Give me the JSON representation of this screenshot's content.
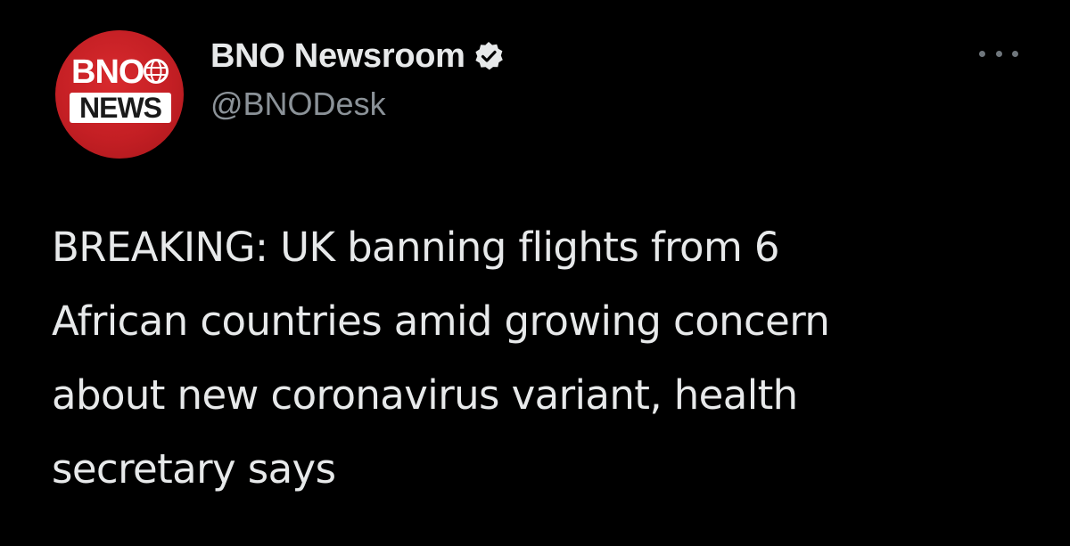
{
  "avatar": {
    "logo_top": "BNO",
    "logo_bottom": "NEWS",
    "logo_color": "#c41f24"
  },
  "author": {
    "display_name": "BNO Newsroom",
    "handle": "@BNODesk",
    "verified": true,
    "verified_icon": "verified-badge-icon"
  },
  "menu": {
    "icon": "more-options-icon"
  },
  "tweet": {
    "lines": [
      "BREAKING: UK banning flights from 6",
      "African countries amid growing concern",
      "about new coronavirus variant, health",
      "secretary says"
    ]
  },
  "colors": {
    "background": "#000000",
    "text_primary": "#e7e9ea",
    "text_secondary": "#8b9298"
  }
}
